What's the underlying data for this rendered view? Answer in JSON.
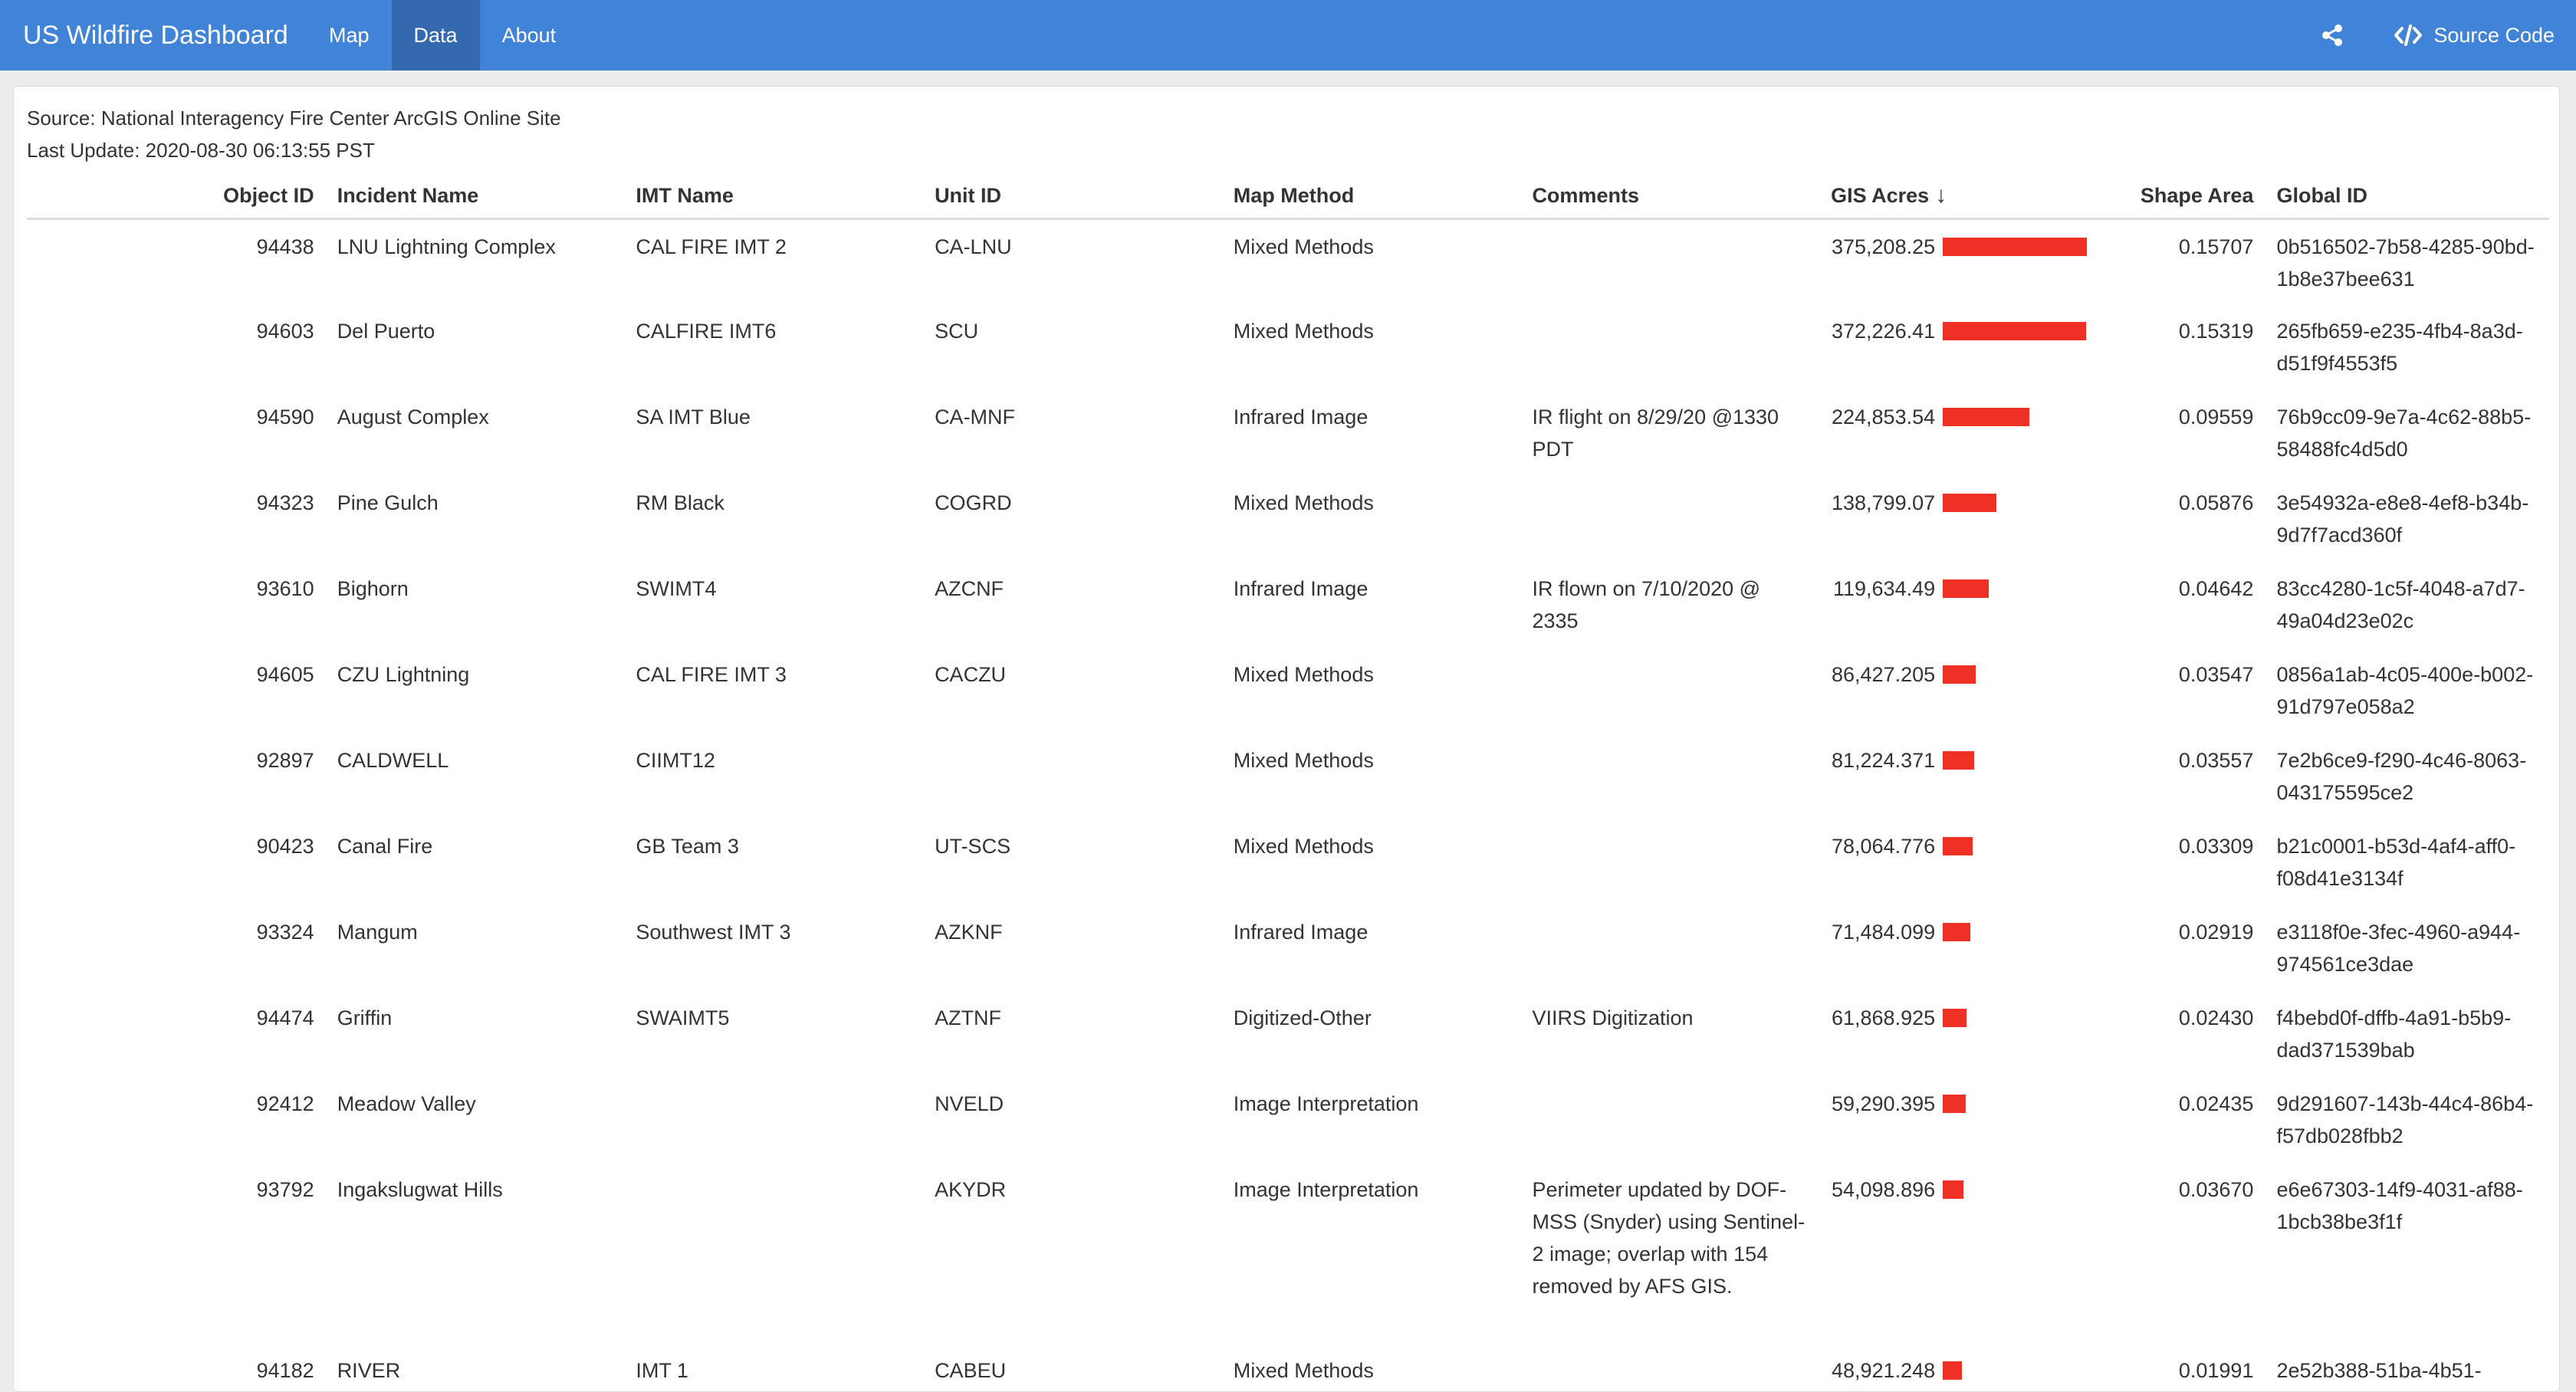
{
  "navbar": {
    "brand": "US Wildfire Dashboard",
    "tabs": [
      {
        "label": "Map",
        "active": false
      },
      {
        "label": "Data",
        "active": true
      },
      {
        "label": "About",
        "active": false
      }
    ],
    "share_icon": "share-icon",
    "source_code_icon": "code-icon",
    "source_code_label": "Source Code",
    "color": "#4183d7"
  },
  "meta": {
    "source": "Source: National Interagency Fire Center ArcGIS Online Site",
    "last_update": "Last Update: 2020-08-30 06:13:55 PST"
  },
  "table": {
    "headers": {
      "object_id": "Object ID",
      "incident_name": "Incident Name",
      "imt_name": "IMT Name",
      "unit_id": "Unit ID",
      "map_method": "Map Method",
      "comments": "Comments",
      "gis_acres": "GIS Acres",
      "sort_indicator": "↓",
      "shape_area": "Shape Area",
      "global_id": "Global ID"
    },
    "bar_color": "#ee3124",
    "bar_max_acres": 375208.25,
    "rows": [
      {
        "object_id": "94438",
        "incident_name": "LNU Lightning Complex",
        "imt_name": "CAL FIRE IMT 2",
        "unit_id": "CA-LNU",
        "map_method": "Mixed Methods",
        "comments": "",
        "gis_acres": "375,208.25",
        "acres_value": 375208.25,
        "shape_area": "0.15707",
        "global_id": "0b516502-7b58-4285-90bd-1b8e37bee631"
      },
      {
        "object_id": "94603",
        "incident_name": "Del Puerto",
        "imt_name": "CALFIRE IMT6",
        "unit_id": "SCU",
        "map_method": "Mixed Methods",
        "comments": "",
        "gis_acres": "372,226.41",
        "acres_value": 372226.41,
        "shape_area": "0.15319",
        "global_id": "265fb659-e235-4fb4-8a3d-d51f9f4553f5"
      },
      {
        "object_id": "94590",
        "incident_name": "August Complex",
        "imt_name": "SA IMT Blue",
        "unit_id": "CA-MNF",
        "map_method": "Infrared Image",
        "comments": "IR flight on 8/29/20 @1330 PDT",
        "gis_acres": "224,853.54",
        "acres_value": 224853.54,
        "shape_area": "0.09559",
        "global_id": "76b9cc09-9e7a-4c62-88b5-58488fc4d5d0"
      },
      {
        "object_id": "94323",
        "incident_name": "Pine Gulch",
        "imt_name": "RM Black",
        "unit_id": "COGRD",
        "map_method": "Mixed Methods",
        "comments": "",
        "gis_acres": "138,799.07",
        "acres_value": 138799.07,
        "shape_area": "0.05876",
        "global_id": "3e54932a-e8e8-4ef8-b34b-9d7f7acd360f"
      },
      {
        "object_id": "93610",
        "incident_name": "Bighorn",
        "imt_name": "SWIMT4",
        "unit_id": "AZCNF",
        "map_method": "Infrared Image",
        "comments": "IR flown on 7/10/2020 @ 2335",
        "gis_acres": "119,634.49",
        "acres_value": 119634.49,
        "shape_area": "0.04642",
        "global_id": "83cc4280-1c5f-4048-a7d7-49a04d23e02c"
      },
      {
        "object_id": "94605",
        "incident_name": "CZU Lightning",
        "imt_name": "CAL FIRE IMT 3",
        "unit_id": "CACZU",
        "map_method": "Mixed Methods",
        "comments": "",
        "gis_acres": "86,427.205",
        "acres_value": 86427.205,
        "shape_area": "0.03547",
        "global_id": "0856a1ab-4c05-400e-b002-91d797e058a2"
      },
      {
        "object_id": "92897",
        "incident_name": "CALDWELL",
        "imt_name": "CIIMT12",
        "unit_id": "",
        "map_method": "Mixed Methods",
        "comments": "",
        "gis_acres": "81,224.371",
        "acres_value": 81224.371,
        "shape_area": "0.03557",
        "global_id": "7e2b6ce9-f290-4c46-8063-043175595ce2"
      },
      {
        "object_id": "90423",
        "incident_name": "Canal Fire",
        "imt_name": "GB Team 3",
        "unit_id": "UT-SCS",
        "map_method": "Mixed Methods",
        "comments": "",
        "gis_acres": "78,064.776",
        "acres_value": 78064.776,
        "shape_area": "0.03309",
        "global_id": "b21c0001-b53d-4af4-aff0-f08d41e3134f"
      },
      {
        "object_id": "93324",
        "incident_name": "Mangum",
        "imt_name": "Southwest IMT 3",
        "unit_id": "AZKNF",
        "map_method": "Infrared Image",
        "comments": "",
        "gis_acres": "71,484.099",
        "acres_value": 71484.099,
        "shape_area": "0.02919",
        "global_id": "e3118f0e-3fec-4960-a944-974561ce3dae"
      },
      {
        "object_id": "94474",
        "incident_name": "Griffin",
        "imt_name": "SWAIMT5",
        "unit_id": "AZTNF",
        "map_method": "Digitized-Other",
        "comments": "VIIRS Digitization",
        "gis_acres": "61,868.925",
        "acres_value": 61868.925,
        "shape_area": "0.02430",
        "global_id": "f4bebd0f-dffb-4a91-b5b9-dad371539bab"
      },
      {
        "object_id": "92412",
        "incident_name": "Meadow Valley",
        "imt_name": "",
        "unit_id": "NVELD",
        "map_method": "Image Interpretation",
        "comments": "",
        "gis_acres": "59,290.395",
        "acres_value": 59290.395,
        "shape_area": "0.02435",
        "global_id": "9d291607-143b-44c4-86b4-f57db028fbb2"
      },
      {
        "object_id": "93792",
        "incident_name": "Ingakslugwat Hills",
        "imt_name": "",
        "unit_id": "AKYDR",
        "map_method": "Image Interpretation",
        "comments": "Perimeter updated by DOF-MSS (Snyder) using Sentinel-2 image; overlap with 154 removed by AFS GIS.",
        "gis_acres": "54,098.896",
        "acres_value": 54098.896,
        "shape_area": "0.03670",
        "global_id": "e6e67303-14f9-4031-af88-1bcb38be3f1f"
      },
      {
        "object_id": "94182",
        "incident_name": "RIVER",
        "imt_name": "IMT 1",
        "unit_id": "CABEU",
        "map_method": "Mixed Methods",
        "comments": "",
        "gis_acres": "48,921.248",
        "acres_value": 48921.248,
        "shape_area": "0.01991",
        "global_id": "2e52b388-51ba-4b51-"
      }
    ]
  }
}
